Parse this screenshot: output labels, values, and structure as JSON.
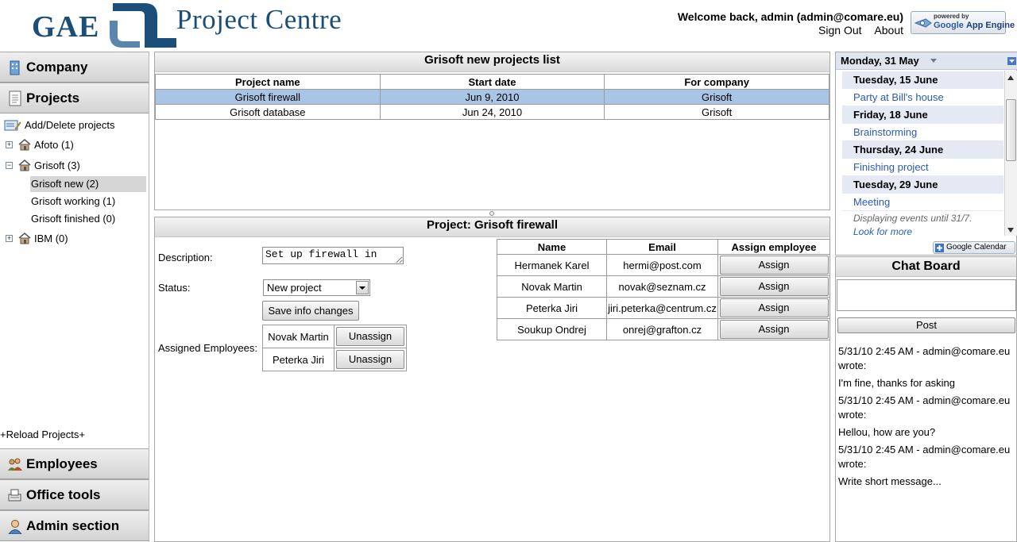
{
  "header": {
    "logo_gae": "GAE",
    "title": "Project Centre",
    "welcome": "Welcome back, admin (admin@comare.eu)",
    "sign_out": "Sign Out",
    "about": "About",
    "badge_powered": "powered by",
    "badge_google": "Google",
    "badge_appengine": "App Engine"
  },
  "sidebar": {
    "company": "Company",
    "projects": "Projects",
    "add_delete": "Add/Delete projects",
    "tree": [
      {
        "label": "Afoto (1)",
        "toggle": "+"
      },
      {
        "label": "Grisoft (3)",
        "toggle": "−"
      },
      {
        "label": "Grisoft new (2)"
      },
      {
        "label": "Grisoft working (1)"
      },
      {
        "label": "Grisoft finished (0)"
      },
      {
        "label": "IBM (0)",
        "toggle": "+"
      }
    ],
    "reload": "+Reload Projects+",
    "employees": "Employees",
    "office_tools": "Office tools",
    "admin_section": "Admin section"
  },
  "projects_list": {
    "title": "Grisoft new projects list",
    "columns": [
      "Project name",
      "Start date",
      "For company"
    ],
    "rows": [
      [
        "Grisoft firewall",
        "Jun 9, 2010",
        "Grisoft"
      ],
      [
        "Grisoft database",
        "Jun 24, 2010",
        "Grisoft"
      ]
    ]
  },
  "project_detail": {
    "title": "Project: Grisoft firewall",
    "description_label": "Description:",
    "description_value": "Set up firewall in",
    "status_label": "Status:",
    "status_value": "New project",
    "save_button": "Save info changes",
    "assigned_label": "Assigned Employees:",
    "assigned": [
      {
        "name": "Novak Martin",
        "action": "Unassign"
      },
      {
        "name": "Peterka Jiri",
        "action": "Unassign"
      }
    ],
    "employees_columns": [
      "Name",
      "Email",
      "Assign employee"
    ],
    "employees": [
      {
        "name": "Hermanek Karel",
        "email": "hermi@post.com",
        "action": "Assign"
      },
      {
        "name": "Novak Martin",
        "email": "novak@seznam.cz",
        "action": "Assign"
      },
      {
        "name": "Peterka Jiri",
        "email": "jiri.peterka@centrum.cz",
        "action": "Assign"
      },
      {
        "name": "Soukup Ondrej",
        "email": "onrej@grafton.cz",
        "action": "Assign"
      }
    ]
  },
  "calendar": {
    "header": "Monday, 31 May",
    "entries": [
      {
        "kind": "date",
        "text": "Tuesday, 15 June"
      },
      {
        "kind": "event",
        "text": "Party at Bill's house"
      },
      {
        "kind": "date",
        "text": "Friday, 18 June"
      },
      {
        "kind": "event",
        "text": "Brainstorming"
      },
      {
        "kind": "date",
        "text": "Thursday, 24 June"
      },
      {
        "kind": "event",
        "text": "Finishing project"
      },
      {
        "kind": "date",
        "text": "Tuesday, 29 June"
      },
      {
        "kind": "event",
        "text": "Meeting"
      }
    ],
    "footer_note": "Displaying events until 31/7.",
    "look_more": "Look for more",
    "badge": "Google Calendar"
  },
  "chat": {
    "title": "Chat Board",
    "post_button": "Post",
    "messages": [
      {
        "meta": "5/31/10 2:45 AM - admin@comare.eu wrote:",
        "text": "I'm fine, thanks for asking"
      },
      {
        "meta": "5/31/10 2:45 AM - admin@comare.eu wrote:",
        "text": "Hellou, how are you?"
      },
      {
        "meta": "5/31/10 2:45 AM - admin@comare.eu wrote:",
        "text": "Write short message..."
      }
    ]
  }
}
